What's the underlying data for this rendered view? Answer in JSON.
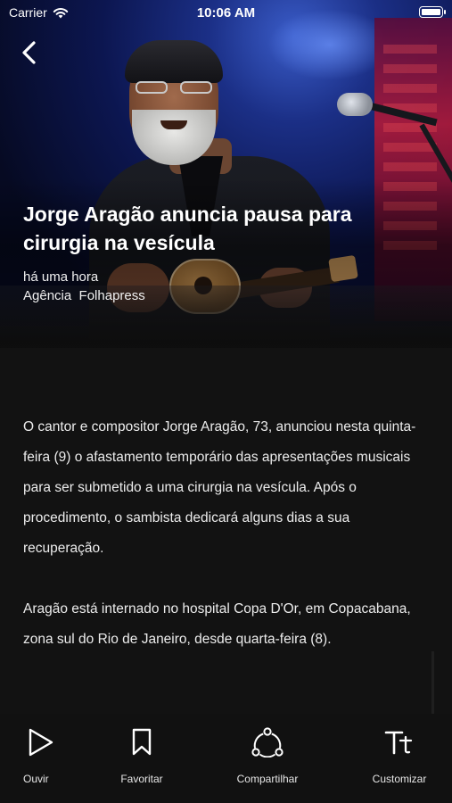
{
  "status_bar": {
    "carrier": "Carrier",
    "time": "10:06 AM"
  },
  "article": {
    "headline": "Jorge Aragão anuncia pausa para cirurgia na vesícula",
    "time_ago": "há uma hora",
    "source": "Agência  Folhapress",
    "paragraphs": [
      "O cantor e compositor Jorge Aragão, 73, anunciou nesta quinta-feira (9) o afastamento temporário das apresentações musicais para ser submetido a uma cirurgia na vesícula. Após o procedimento, o sambista dedicará alguns dias a sua recuperação.",
      "Aragão está internado no hospital Copa D'Or, em Copacabana, zona sul do Rio de Janeiro, desde quarta-feira (8)."
    ]
  },
  "toolbar": {
    "listen_label": "Ouvir",
    "favorite_label": "Favoritar",
    "share_label": "Compartilhar",
    "customize_label": "Customizar"
  },
  "icons": {
    "back": "chevron-left-icon",
    "listen": "play-icon",
    "favorite": "bookmark-icon",
    "share": "share-icon",
    "customize": "text-size-icon"
  }
}
